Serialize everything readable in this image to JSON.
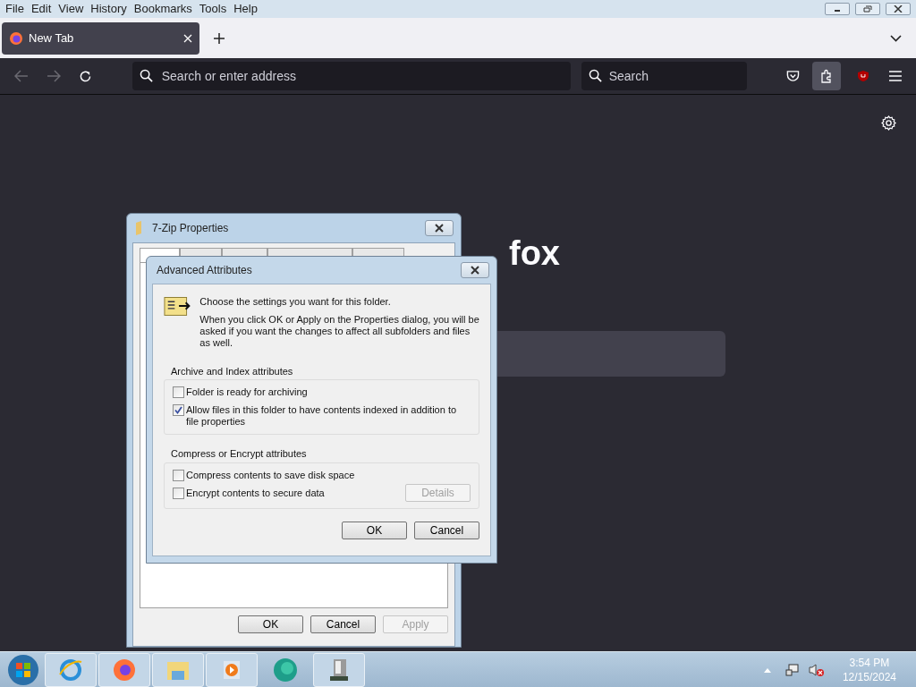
{
  "menu_bar": [
    "File",
    "Edit",
    "View",
    "History",
    "Bookmarks",
    "Tools",
    "Help"
  ],
  "tabs": [
    {
      "label": "New Tab",
      "selected": true
    }
  ],
  "address_bar": {
    "placeholder": "Search or enter address"
  },
  "search_bar": {
    "placeholder": "Search"
  },
  "page": {
    "brand_text": "fox"
  },
  "properties_window": {
    "title": "7-Zip Properties",
    "tabs": [
      {
        "selected": true
      },
      {
        "selected": false
      },
      {
        "selected": false
      },
      {
        "selected": false
      },
      {
        "selected": false
      }
    ],
    "buttons": [
      {
        "label": "OK",
        "disabled": false
      },
      {
        "label": "Cancel",
        "disabled": false
      },
      {
        "label": "Apply",
        "disabled": true
      }
    ]
  },
  "advanced_attributes": {
    "title": "Advanced Attributes",
    "intro": "Choose the settings you want for this folder.",
    "note": "When you click OK or Apply on the Properties dialog, you will be asked if you want the changes to affect all subfolders and files as well.",
    "groups": [
      {
        "title": "Archive and Index attributes",
        "options": [
          {
            "label": "Folder is ready for archiving",
            "checked": false
          },
          {
            "label": "Allow files in this folder to have contents indexed in addition to file properties",
            "checked": true
          }
        ]
      },
      {
        "title": "Compress or Encrypt attributes",
        "options": [
          {
            "label": "Compress contents to save disk space",
            "checked": false
          },
          {
            "label": "Encrypt contents to secure data",
            "checked": false
          }
        ],
        "button": {
          "label": "Details",
          "disabled": true
        }
      }
    ],
    "buttons": [
      {
        "label": "OK",
        "disabled": false
      },
      {
        "label": "Cancel",
        "disabled": false
      }
    ]
  },
  "clock": {
    "time": "3:54 PM",
    "date": "12/15/2024"
  }
}
